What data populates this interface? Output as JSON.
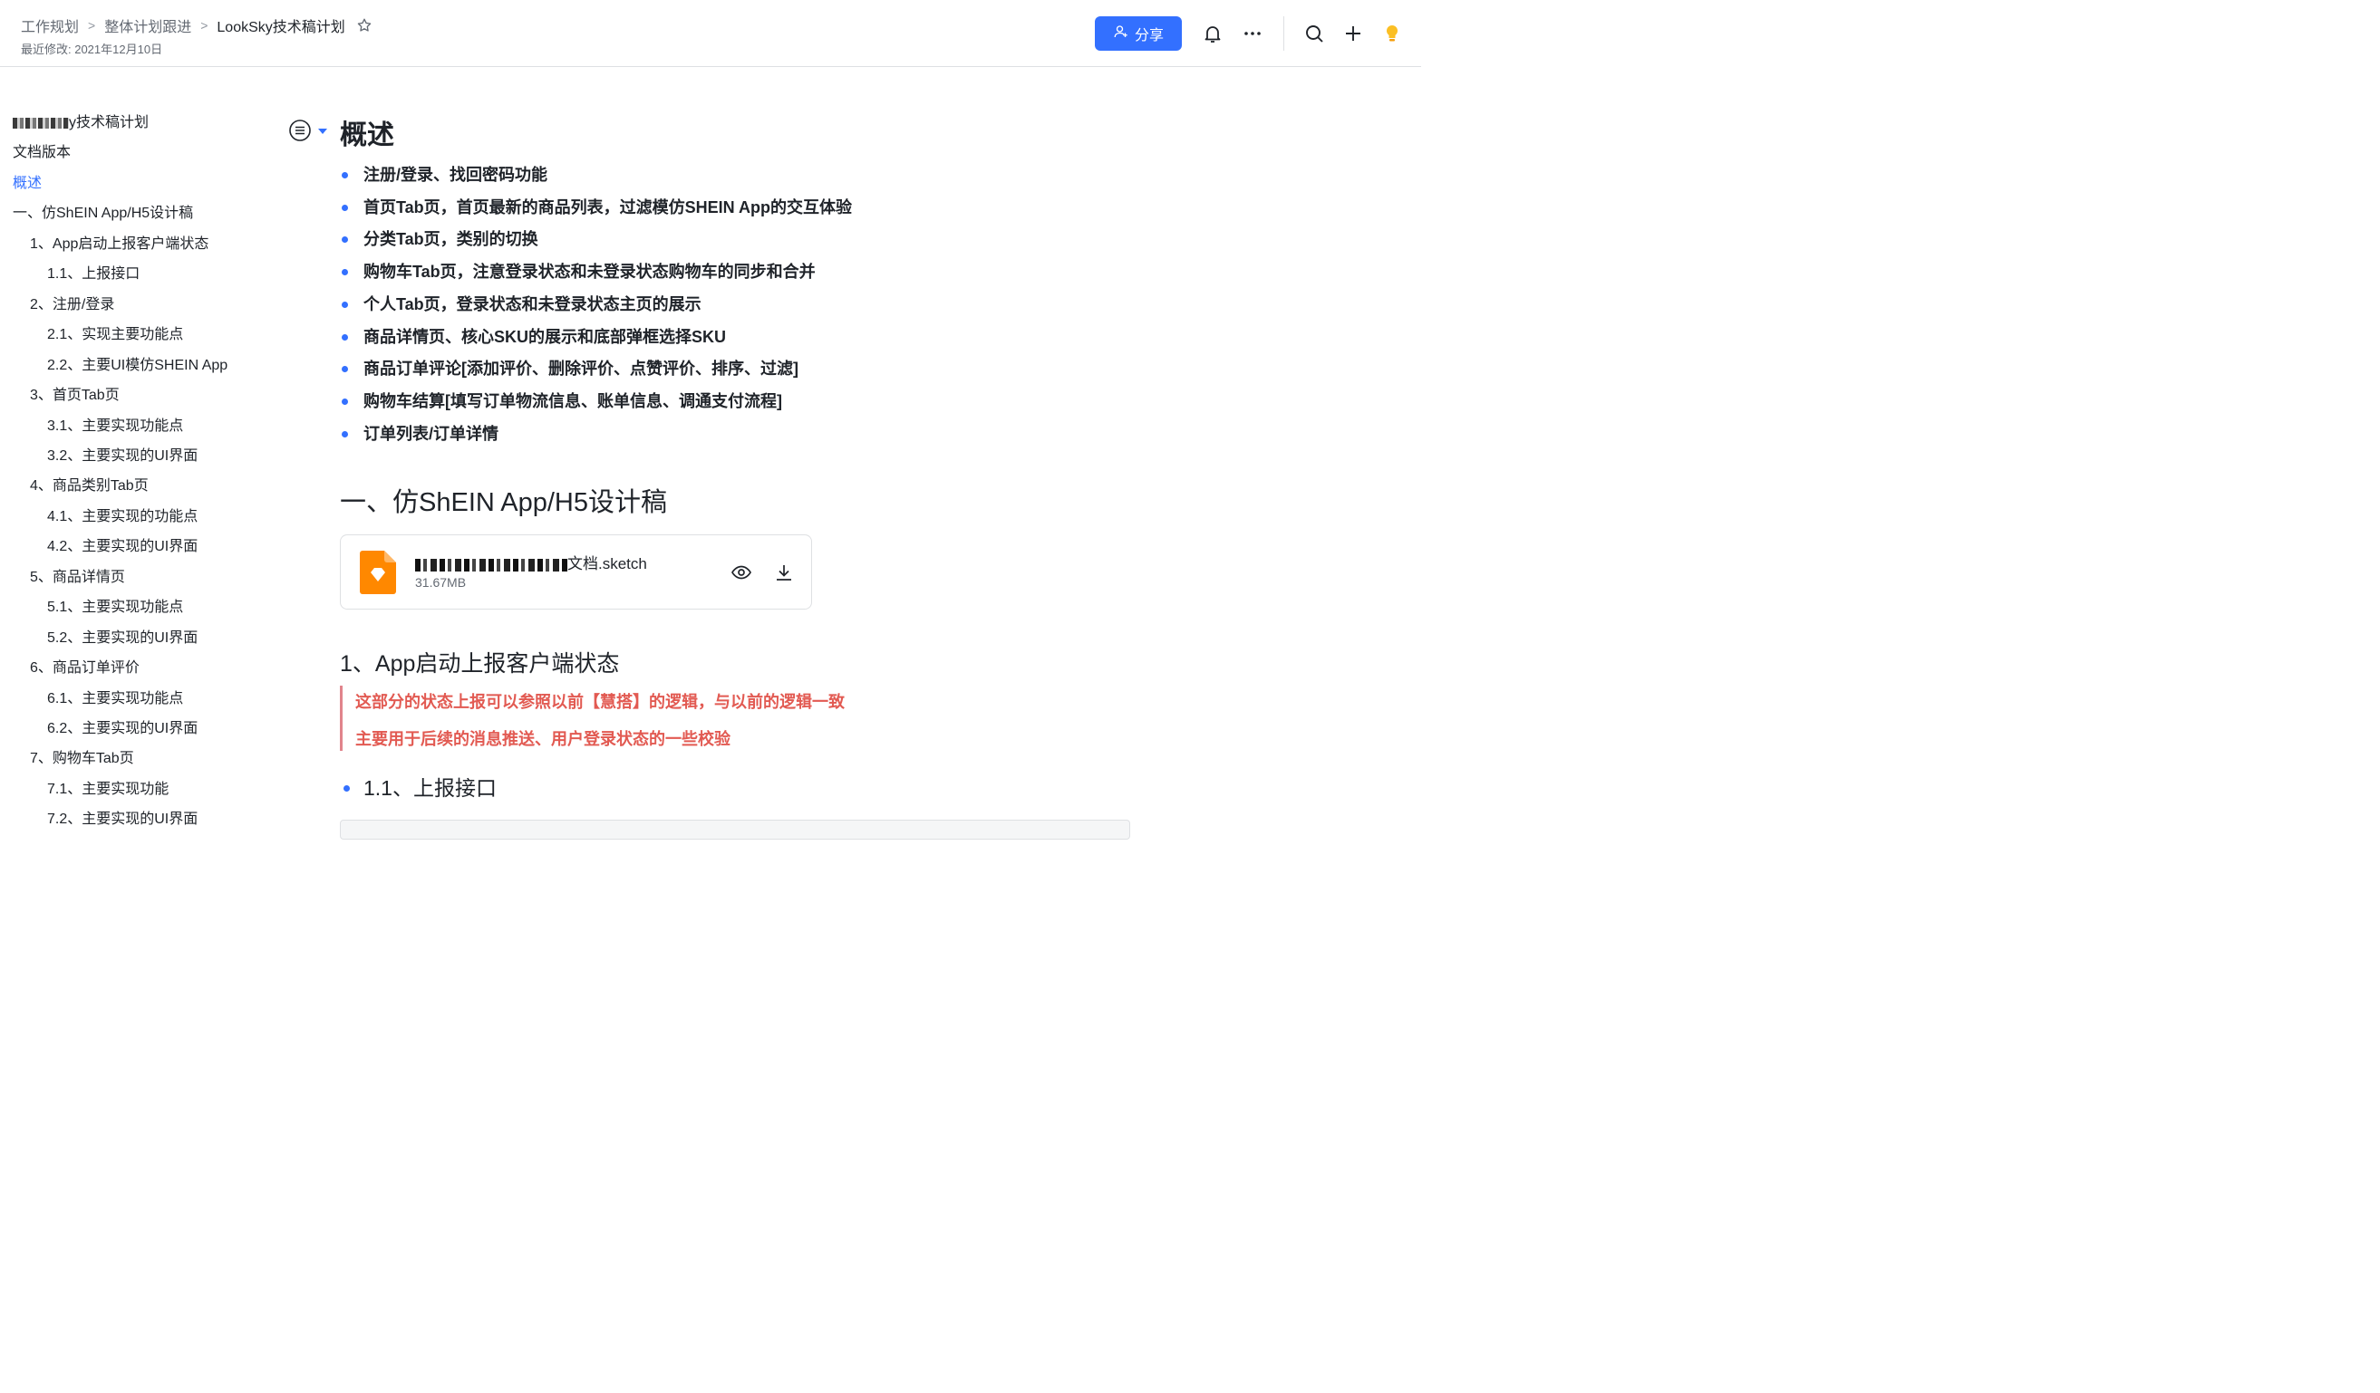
{
  "header": {
    "breadcrumb": [
      "工作规划",
      "整体计划跟进",
      "LookSky技术稿计划"
    ],
    "last_modified": "最近修改: 2021年12月10日",
    "share_label": "分享",
    "accent_color": "#3370ff"
  },
  "toc": {
    "items": [
      {
        "label": "y技术稿计划",
        "level": 0,
        "redacted_prefix": true
      },
      {
        "label": "文档版本",
        "level": 0
      },
      {
        "label": "概述",
        "level": 0,
        "active": true
      },
      {
        "label": "一、仿ShEIN App/H5设计稿",
        "level": 0
      },
      {
        "label": "1、App启动上报客户端状态",
        "level": 1
      },
      {
        "label": "1.1、上报接口",
        "level": 2
      },
      {
        "label": "2、注册/登录",
        "level": 1
      },
      {
        "label": "2.1、实现主要功能点",
        "level": 2
      },
      {
        "label": "2.2、主要UI模仿SHEIN App",
        "level": 2
      },
      {
        "label": "3、首页Tab页",
        "level": 1
      },
      {
        "label": "3.1、主要实现功能点",
        "level": 2
      },
      {
        "label": "3.2、主要实现的UI界面",
        "level": 2
      },
      {
        "label": "4、商品类别Tab页",
        "level": 1
      },
      {
        "label": "4.1、主要实现的功能点",
        "level": 2
      },
      {
        "label": "4.2、主要实现的UI界面",
        "level": 2
      },
      {
        "label": "5、商品详情页",
        "level": 1
      },
      {
        "label": "5.1、主要实现功能点",
        "level": 2
      },
      {
        "label": "5.2、主要实现的UI界面",
        "level": 2
      },
      {
        "label": "6、商品订单评价",
        "level": 1
      },
      {
        "label": "6.1、主要实现功能点",
        "level": 2
      },
      {
        "label": "6.2、主要实现的UI界面",
        "level": 2
      },
      {
        "label": "7、购物车Tab页",
        "level": 1
      },
      {
        "label": "7.1、主要实现功能",
        "level": 2
      },
      {
        "label": "7.2、主要实现的UI界面",
        "level": 2
      }
    ]
  },
  "content": {
    "overview_title": "概述",
    "bullets": [
      "注册/登录、找回密码功能",
      "首页Tab页，首页最新的商品列表，过滤模仿SHEIN App的交互体验",
      "分类Tab页，类别的切换",
      "购物车Tab页，注意登录状态和未登录状态购物车的同步和合并",
      "个人Tab页，登录状态和未登录状态主页的展示",
      "商品详情页、核心SKU的展示和底部弹框选择SKU",
      "商品订单评论[添加评价、删除评价、点赞评价、排序、过滤]",
      "购物车结算[填写订单物流信息、账单信息、调通支付流程]",
      "订单列表/订单详情"
    ],
    "section1_title": "一、仿ShEIN App/H5设计稿",
    "file": {
      "name_suffix": "文档.sketch",
      "size": "31.67MB",
      "icon_color": "#ff8800"
    },
    "subsection_title": "1、App启动上报客户端状态",
    "quote_lines": [
      "这部分的状态上报可以参照以前【慧搭】的逻辑，与以前的逻辑一致",
      "主要用于后续的消息推送、用户登录状态的一些校验"
    ],
    "quote_color": "#e25a52",
    "subsubsection_title": "1.1、上报接口"
  }
}
